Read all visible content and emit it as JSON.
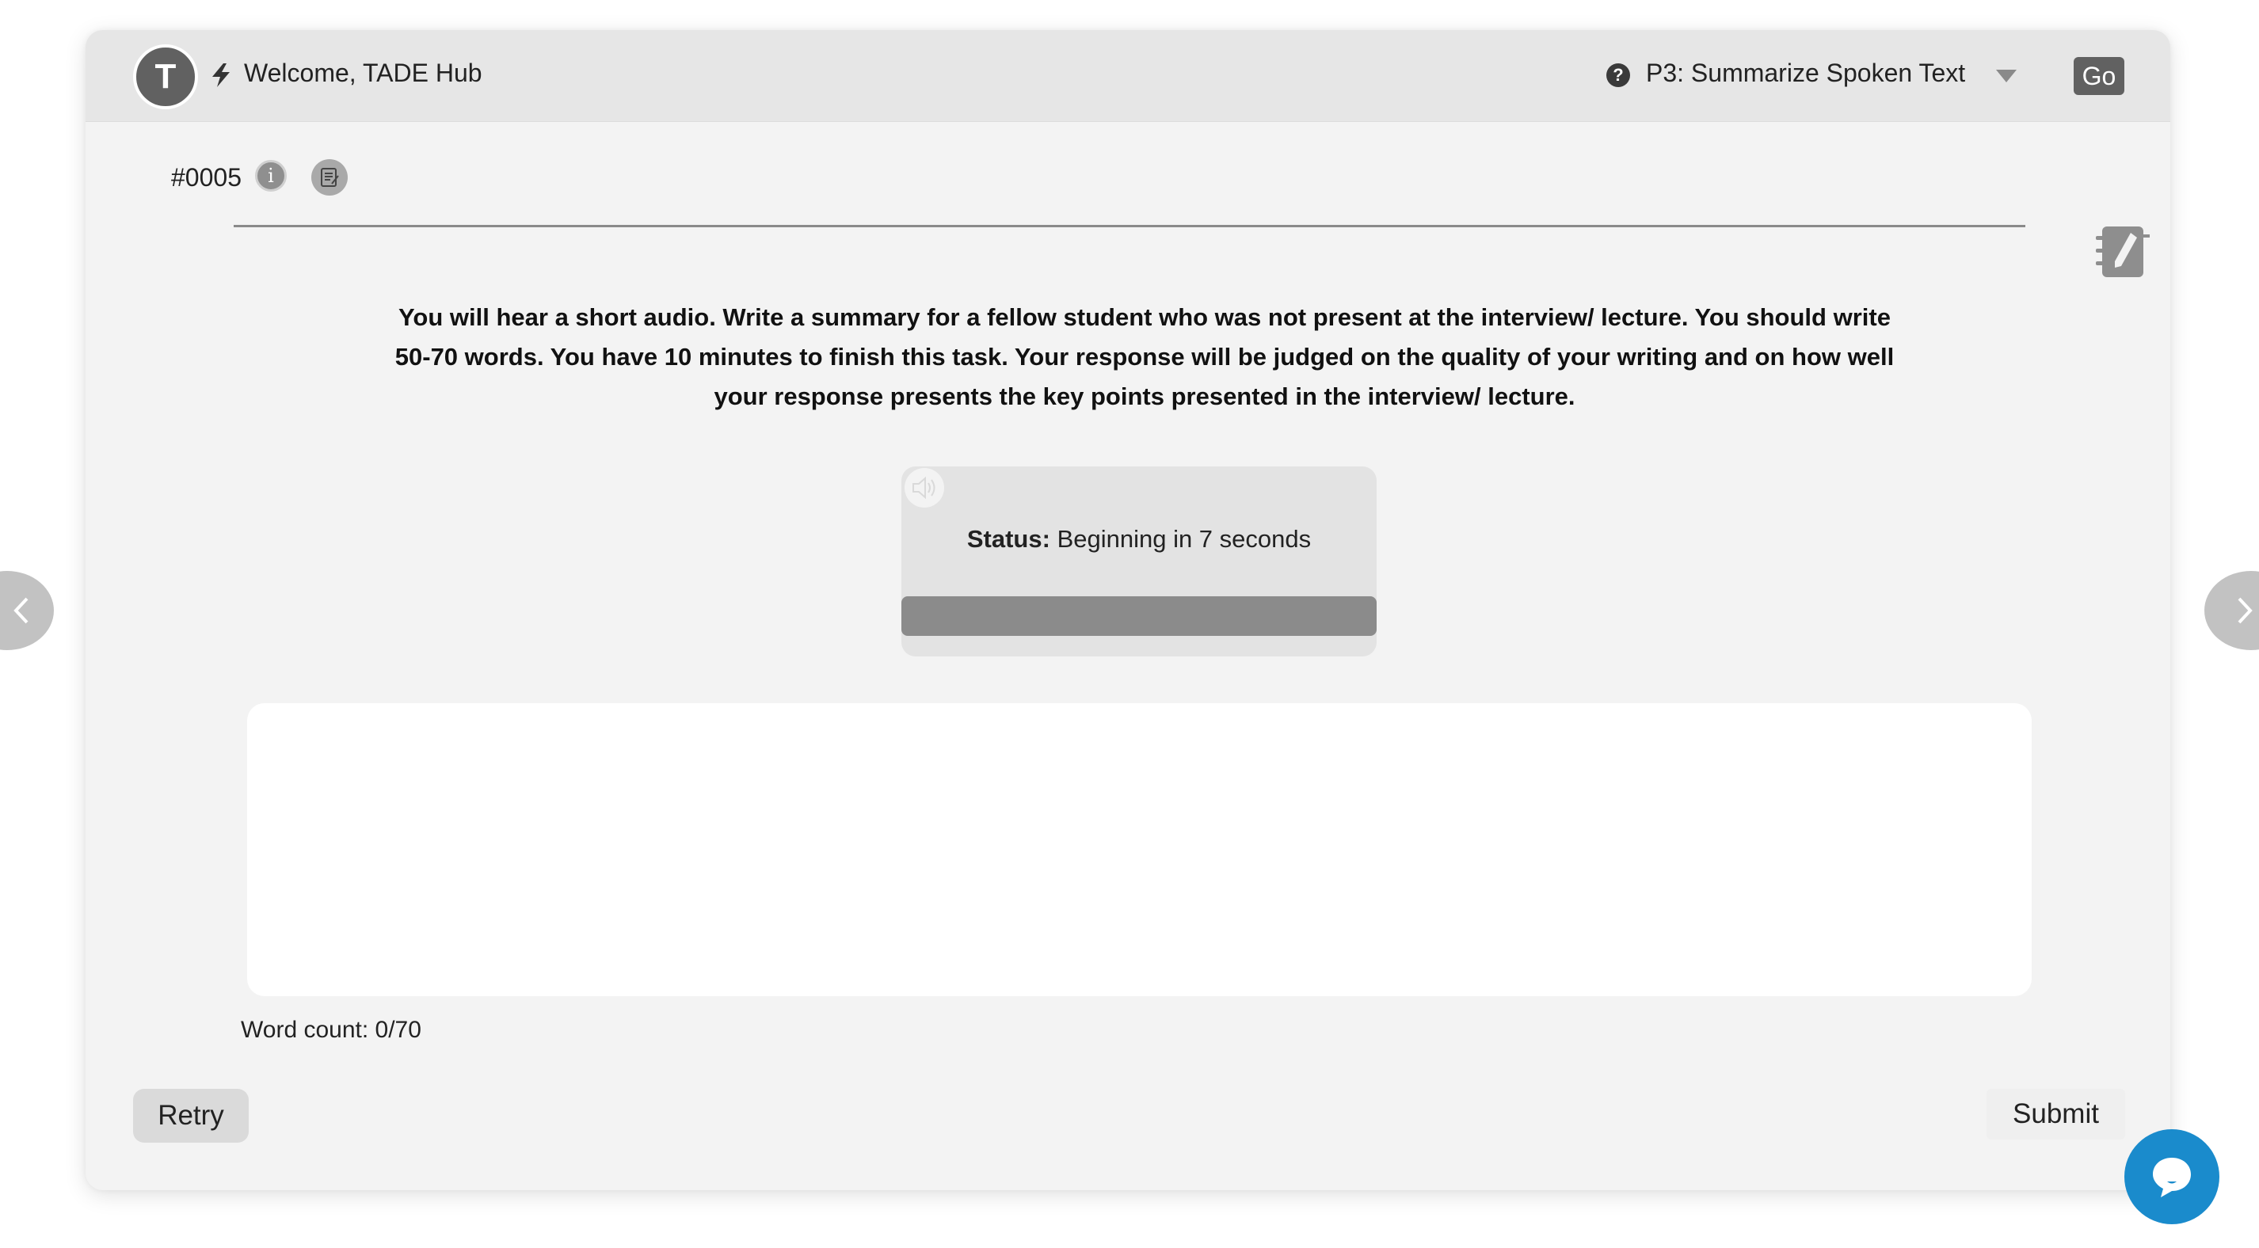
{
  "header": {
    "avatar_letter": "T",
    "welcome_text": "Welcome, TADE Hub",
    "task_select_value": "P3: Summarize Spoken Text",
    "go_label": "Go"
  },
  "question": {
    "id": "#0005",
    "info_icon_glyph": "i",
    "instructions": "You will hear a short audio. Write a summary for a fellow student who was not present at the interview/ lecture. You should write 50-70 words. You have 10 minutes to finish this task. Your response will be judged on the quality of your writing and on how well your response presents the key points presented in the interview/ lecture."
  },
  "audio": {
    "status_label": "Status:",
    "status_value": "Beginning in 7 seconds",
    "progress_percent": 0
  },
  "answer": {
    "value": "",
    "placeholder": ""
  },
  "word_count": "Word count: 0/70",
  "actions": {
    "retry_label": "Retry",
    "submit_label": "Submit"
  },
  "icons": {
    "bolt": "lightning-bolt-icon",
    "help": "question-circle-icon",
    "caret": "triangle-down-icon",
    "info": "info-circle-icon",
    "script": "script-scroll-icon",
    "notebook": "notebook-pencil-icon",
    "speaker": "speaker-volume-icon",
    "prev": "chevron-left-icon",
    "next": "chevron-right-icon",
    "chat": "chat-bubble-icon"
  },
  "colors": {
    "chat_accent": "#1a8bcc",
    "header_bg": "#e6e6e6",
    "card_bg": "#f3f3f3"
  }
}
